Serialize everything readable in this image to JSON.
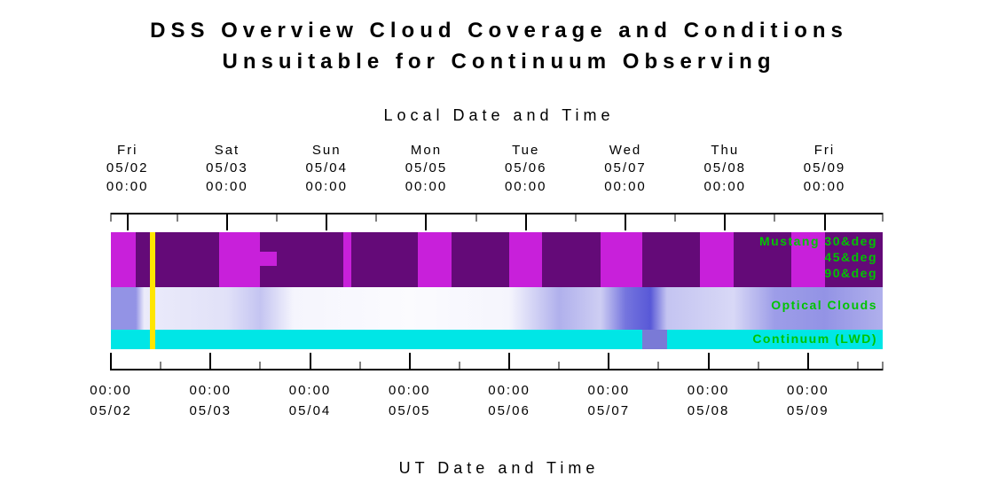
{
  "title_line1": "DSS Overview Cloud Coverage and Conditions",
  "title_line2": "Unsuitable for Continuum Observing",
  "top_axis_label": "Local Date and Time",
  "bottom_axis_label": "UT Date and Time",
  "legend": {
    "mustang_30": "Mustang 30&deg",
    "mustang_45": "45&deg",
    "mustang_90": "90&deg",
    "optical": "Optical Clouds",
    "continuum": "Continuum (LWD)"
  },
  "chart_data": {
    "type": "heatmap",
    "x_range_hours": [
      0,
      186
    ],
    "local_ticks": [
      {
        "hour": 4,
        "day": "Fri",
        "date": "05/02",
        "time": "00:00"
      },
      {
        "hour": 28,
        "day": "Sat",
        "date": "05/03",
        "time": "00:00"
      },
      {
        "hour": 52,
        "day": "Sun",
        "date": "05/04",
        "time": "00:00"
      },
      {
        "hour": 76,
        "day": "Mon",
        "date": "05/05",
        "time": "00:00"
      },
      {
        "hour": 100,
        "day": "Tue",
        "date": "05/06",
        "time": "00:00"
      },
      {
        "hour": 124,
        "day": "Wed",
        "date": "05/07",
        "time": "00:00"
      },
      {
        "hour": 148,
        "day": "Thu",
        "date": "05/08",
        "time": "00:00"
      },
      {
        "hour": 172,
        "day": "Fri",
        "date": "05/09",
        "time": "00:00"
      }
    ],
    "ut_ticks": [
      {
        "hour": 0,
        "time": "00:00",
        "date": "05/02"
      },
      {
        "hour": 24,
        "time": "00:00",
        "date": "05/03"
      },
      {
        "hour": 48,
        "time": "00:00",
        "date": "05/04"
      },
      {
        "hour": 72,
        "time": "00:00",
        "date": "05/05"
      },
      {
        "hour": 96,
        "time": "00:00",
        "date": "05/06"
      },
      {
        "hour": 120,
        "time": "00:00",
        "date": "05/07"
      },
      {
        "hour": 144,
        "time": "00:00",
        "date": "05/08"
      },
      {
        "hour": 168,
        "time": "00:00",
        "date": "05/09"
      }
    ],
    "marker_hour": 10,
    "bands": {
      "mustang": {
        "base_color": "#640a78",
        "bright_color": "#c820da",
        "bright_segments_hours": [
          [
            0,
            6
          ],
          [
            26,
            36
          ],
          [
            56,
            58
          ],
          [
            74,
            82
          ],
          [
            96,
            104
          ],
          [
            118,
            128
          ],
          [
            142,
            150
          ],
          [
            164,
            172
          ]
        ],
        "spot_hours": {
          "start": 36,
          "end": 40,
          "row": "45deg"
        }
      },
      "optical_clouds": {
        "scale": "0=clear/white, 1=overcast/dark-blue",
        "gradient_stops_hours": [
          {
            "hour": 0,
            "v": 0.55
          },
          {
            "hour": 6,
            "v": 0.55
          },
          {
            "hour": 8,
            "v": 0.1
          },
          {
            "hour": 28,
            "v": 0.15
          },
          {
            "hour": 36,
            "v": 0.3
          },
          {
            "hour": 44,
            "v": 0.05
          },
          {
            "hour": 72,
            "v": 0.02
          },
          {
            "hour": 96,
            "v": 0.05
          },
          {
            "hour": 108,
            "v": 0.4
          },
          {
            "hour": 118,
            "v": 0.25
          },
          {
            "hour": 124,
            "v": 0.7
          },
          {
            "hour": 130,
            "v": 0.85
          },
          {
            "hour": 134,
            "v": 0.3
          },
          {
            "hour": 150,
            "v": 0.2
          },
          {
            "hour": 160,
            "v": 0.5
          },
          {
            "hour": 172,
            "v": 0.55
          },
          {
            "hour": 186,
            "v": 0.4
          }
        ]
      },
      "continuum_lwd": {
        "ok_color": "#00e6e6",
        "bad_color": "#7a7ad6",
        "bad_segments_hours": [
          [
            128,
            134
          ]
        ]
      }
    }
  }
}
